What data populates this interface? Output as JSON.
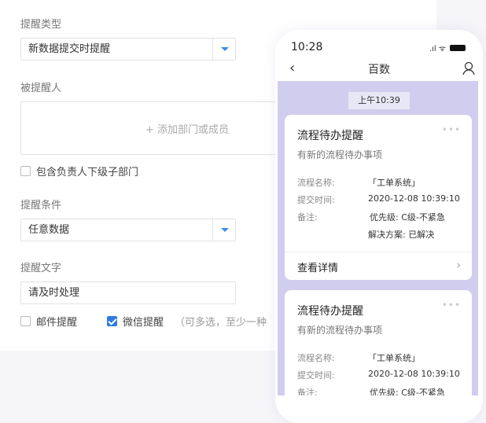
{
  "form": {
    "type_label": "提醒类型",
    "type_value": "新数据提交时提醒",
    "recipient_label": "被提醒人",
    "add_member": "+ 添加部门或成员",
    "include_sub": "包含负责人下级子部门",
    "condition_label": "提醒条件",
    "condition_value": "任意数据",
    "text_label": "提醒文字",
    "text_value": "请及时处理",
    "email": "邮件提醒",
    "email_checked": false,
    "wechat": "微信提醒",
    "wechat_checked": true,
    "hint": "（可多选，至少一种"
  },
  "phone": {
    "clock": "10:28",
    "signal": ".ıl ᯤ",
    "title": "百数",
    "chat_time": "上午10:39",
    "cards": [
      {
        "title": "流程待办提醒",
        "subtitle": "有新的流程待办事项",
        "name_label": "流程名称:",
        "name": "「工单系统」",
        "time_label": "提交时间:",
        "time": "2020-12-08 10:39:10",
        "note_label": "备注:",
        "priority": "优先级: C级-不紧急",
        "solution": "解决方案: 已解决",
        "more": "•••",
        "details": "查看详情"
      },
      {
        "title": "流程待办提醒",
        "subtitle": "有新的流程待办事项",
        "name_label": "流程名称:",
        "name": "「工单系统」",
        "time_label": "提交时间:",
        "time": "2020-12-08 10:39:10",
        "note_label": "备注:",
        "priority": "优先级: C级-不紧急",
        "more": "•••"
      }
    ]
  }
}
